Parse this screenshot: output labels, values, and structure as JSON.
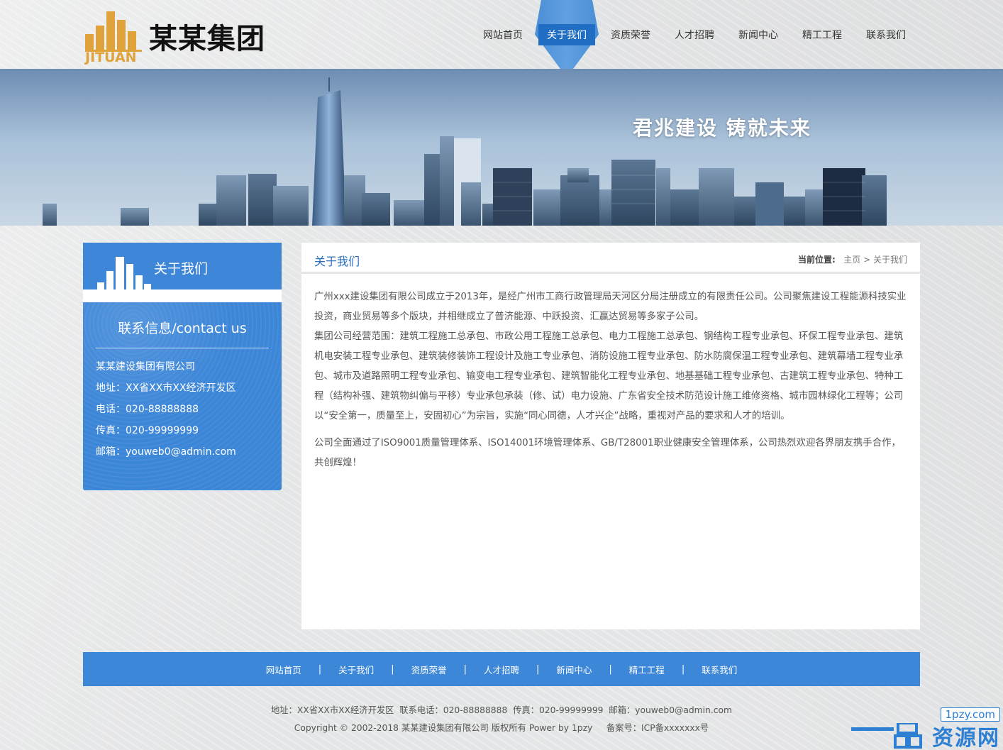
{
  "brand": {
    "name_cn": "某某集团",
    "name_en": "JITUAN",
    "logo_color": "#e0a33b"
  },
  "nav": {
    "items": [
      {
        "label": "网站首页",
        "active": false
      },
      {
        "label": "关于我们",
        "active": true
      },
      {
        "label": "资质荣誉",
        "active": false
      },
      {
        "label": "人才招聘",
        "active": false
      },
      {
        "label": "新闻中心",
        "active": false
      },
      {
        "label": "精工工程",
        "active": false
      },
      {
        "label": "联系我们",
        "active": false
      }
    ],
    "active_color": "#1f6ec4"
  },
  "banner": {
    "slogan": "君兆建设 铸就未来"
  },
  "sidebar": {
    "title": "关于我们",
    "contact_title": "联系信息/contact us",
    "lines": [
      "某某建设集团有限公司",
      "地址：XX省XX市XX经济开发区",
      "电话：020-88888888",
      "传真：020-99999999",
      "邮箱：youweb0@admin.com"
    ],
    "accent": "#3d87d8"
  },
  "main": {
    "title": "关于我们",
    "breadcrumb": {
      "label": "当前位置:",
      "home": "主页",
      "sep": ">",
      "current": "关于我们"
    },
    "paragraphs": [
      "广州xxx建设集团有限公司成立于2013年，是经广州市工商行政管理局天河区分局注册成立的有限责任公司。公司聚焦建设工程能源科技实业投资，商业贸易等多个版块，并相继成立了普济能源、中跃投资、汇赢达贸易等多家子公司。",
      "集团公司经营范围：建筑工程施工总承包、市政公用工程施工总承包、电力工程施工总承包、钢结构工程专业承包、环保工程专业承包、建筑机电安装工程专业承包、建筑装修装饰工程设计及施工专业承包、消防设施工程专业承包、防水防腐保温工程专业承包、建筑幕墙工程专业承包、城市及道路照明工程专业承包、输变电工程专业承包、建筑智能化工程专业承包、地基基础工程专业承包、古建筑工程专业承包、特种工程（结构补强、建筑物纠偏与平移）专业承包承装（修、试）电力设施、广东省安全技术防范设计施工维修资格、城市园林绿化工程等；公司以“安全第一，质量至上，安固初心”为宗旨，实施“同心同德，人才兴企”战略，重视对产品的要求和人才的培训。",
      "公司全面通过了ISO9001质量管理体系、ISO14001环境管理体系、GB/T28001职业健康安全管理体系，公司热烈欢迎各界朋友携手合作，共创辉煌！"
    ]
  },
  "footer": {
    "nav": [
      "网站首页",
      "关于我们",
      "资质荣誉",
      "人才招聘",
      "新闻中心",
      "精工工程",
      "联系我们"
    ],
    "separator": "|",
    "info_line": "地址：XX省XX市XX经济开发区  联系电话：020-88888888  传真：020-99999999  邮箱：youweb0@admin.com",
    "copyright_line": "Copyright © 2002-2018 某某建设集团有限公司 版权所有 Power by 1pzy     备案号：ICP备xxxxxxx号"
  },
  "watermark": {
    "url": "1pzy.com",
    "text": "资源网"
  }
}
